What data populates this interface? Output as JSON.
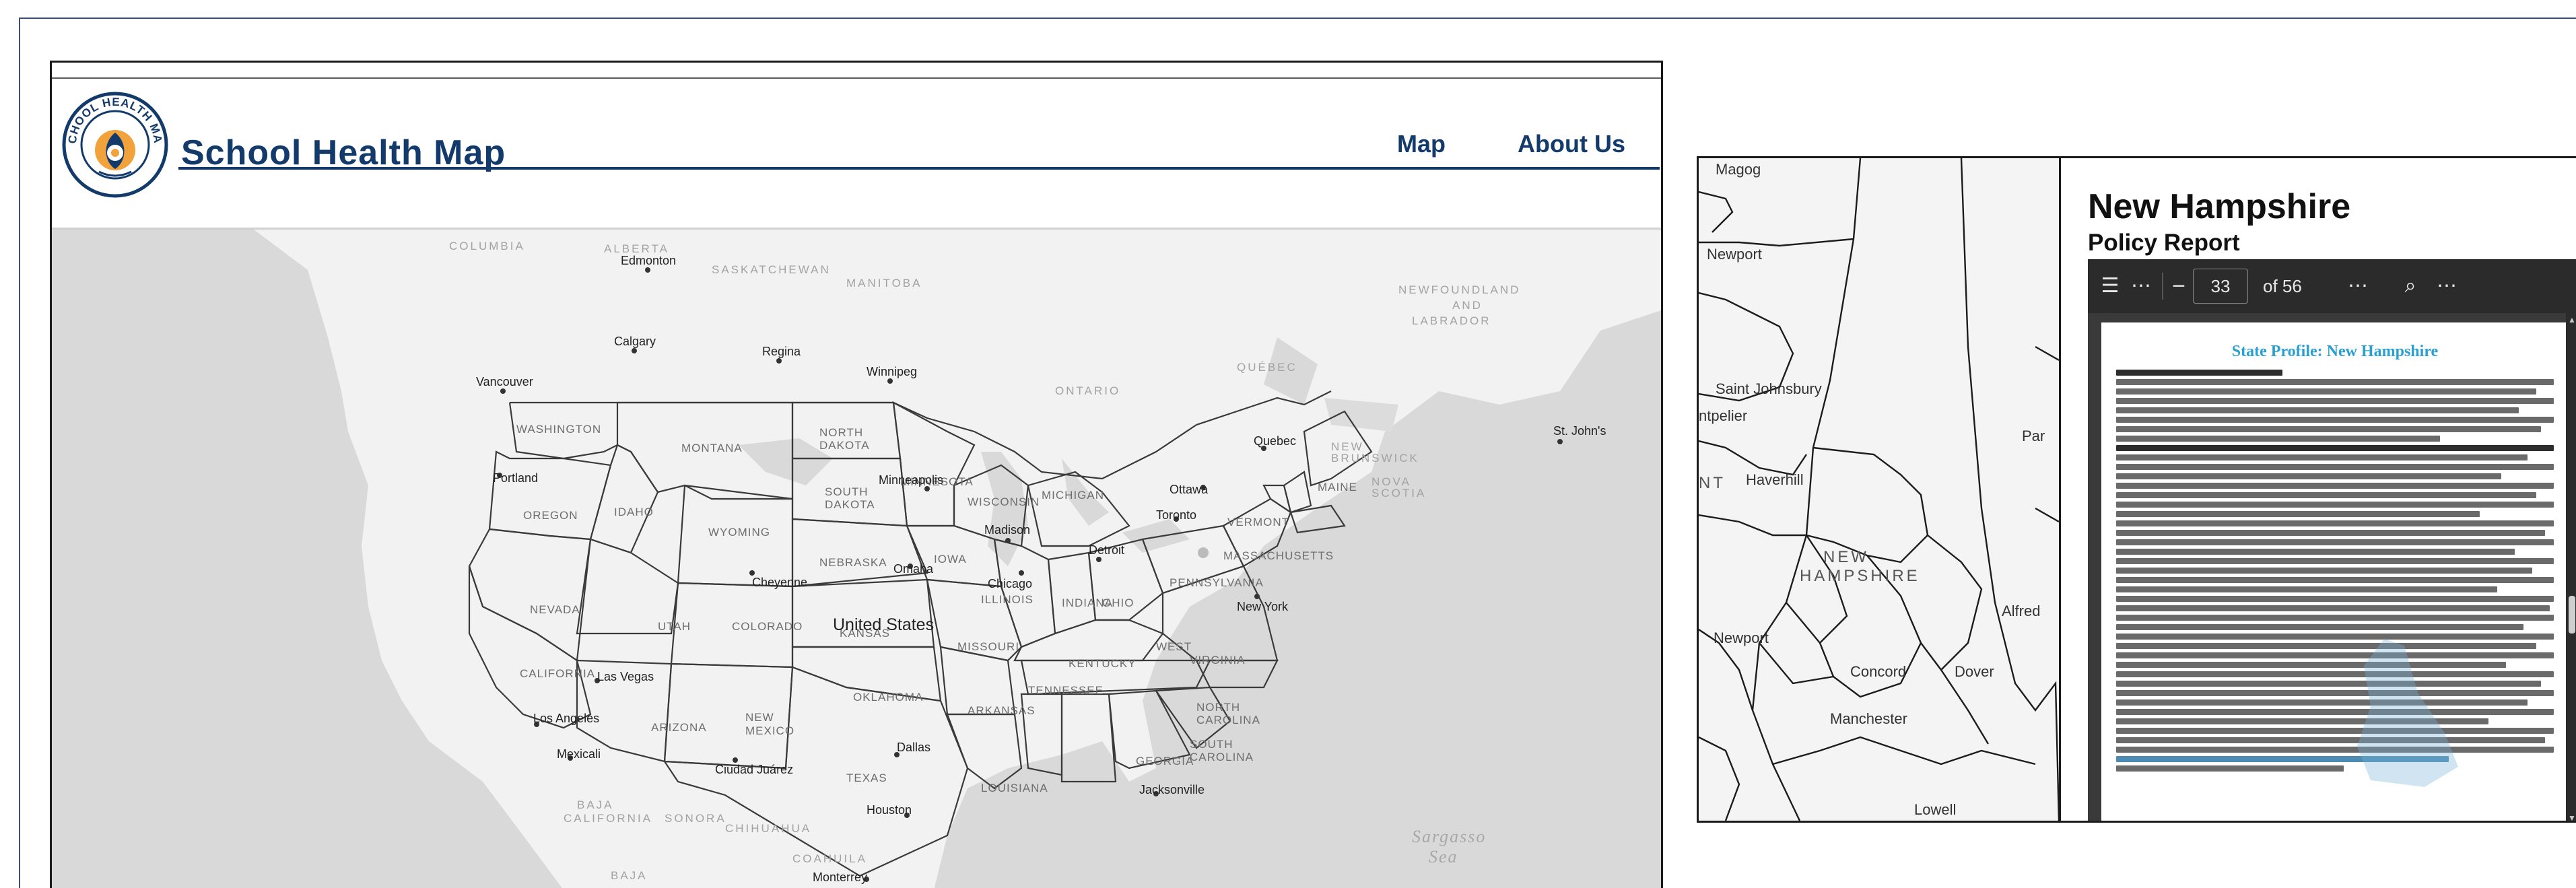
{
  "site": {
    "title": "School Health Map",
    "logo_text": "SCHOOL HEALTH MAP",
    "nav": {
      "map": "Map",
      "about": "About Us"
    }
  },
  "map": {
    "countries": {
      "canada": "",
      "usa": "United States"
    },
    "canada_regions": [
      "ALBERTA",
      "COLUMBIA",
      "SASKATCHEWAN",
      "MANITOBA",
      "ONTARIO",
      "QUÉBEC",
      "NEWFOUNDLAND",
      "AND",
      "LABRADOR",
      "NEW",
      "BRUNSWICK",
      "NOVA",
      "SCOTIA"
    ],
    "states": [
      "WASHINGTON",
      "MONTANA",
      "NORTH",
      "DAKOTA",
      "MINNESOTA",
      "SOUTH",
      "DAKOTA",
      "WISCONSIN",
      "MICHIGAN",
      "OREGON",
      "IDAHO",
      "WYOMING",
      "IOWA",
      "NEBRASKA",
      "ILLINOIS",
      "INDIANA",
      "OHIO",
      "PENNSYLVANIA",
      "NEVADA",
      "UTAH",
      "COLORADO",
      "KANSAS",
      "MISSOURI",
      "KENTUCKY",
      "VIRGINIA",
      "CALIFORNIA",
      "ARIZONA",
      "NEW",
      "MEXICO",
      "OKLAHOMA",
      "ARKANSAS",
      "TENNESSEE",
      "NORTH",
      "CAROLINA",
      "SOUTH",
      "CAROLINA",
      "TEXAS",
      "LOUISIANA",
      "GEORGIA",
      "MAINE",
      "VERMONT",
      "MASSACHUSETTS",
      "WEST"
    ],
    "mexico_regions": [
      "BAJA",
      "CALIFORNIA",
      "SONORA",
      "CHIHUAHUA",
      "COAHUILA",
      "BAJA"
    ],
    "cities": [
      "Edmonton",
      "Calgary",
      "Regina",
      "Winnipeg",
      "Vancouver",
      "Portland",
      "Minneapolis",
      "Ottawa",
      "Toronto",
      "Quebec",
      "St. John's",
      "Madison",
      "Detroit",
      "Chicago",
      "Omaha",
      "Cheyenne",
      "New York",
      "Las Vegas",
      "Los Angeles",
      "Mexicali",
      "Ciudad Juárez",
      "Dallas",
      "Houston",
      "Monterrey",
      "Jacksonville"
    ],
    "sea": [
      "Sargasso",
      "Sea"
    ]
  },
  "detail": {
    "state_title": "New Hampshire",
    "subtitle": "Policy Report",
    "map_labels": {
      "cities": [
        "Magog",
        "Newport",
        "Saint Johnsbury",
        "ntpelier",
        "Haverhill",
        "Newport",
        "Concord",
        "Manchester",
        "Dover",
        "Alfred",
        "Lowell",
        "Par"
      ],
      "state": [
        "NEW",
        "HAMPSHIRE"
      ],
      "partial_state": "NT"
    },
    "pdf": {
      "page": "33",
      "of_label": "of 56",
      "page_title": "State Profile: New Hampshire"
    }
  }
}
